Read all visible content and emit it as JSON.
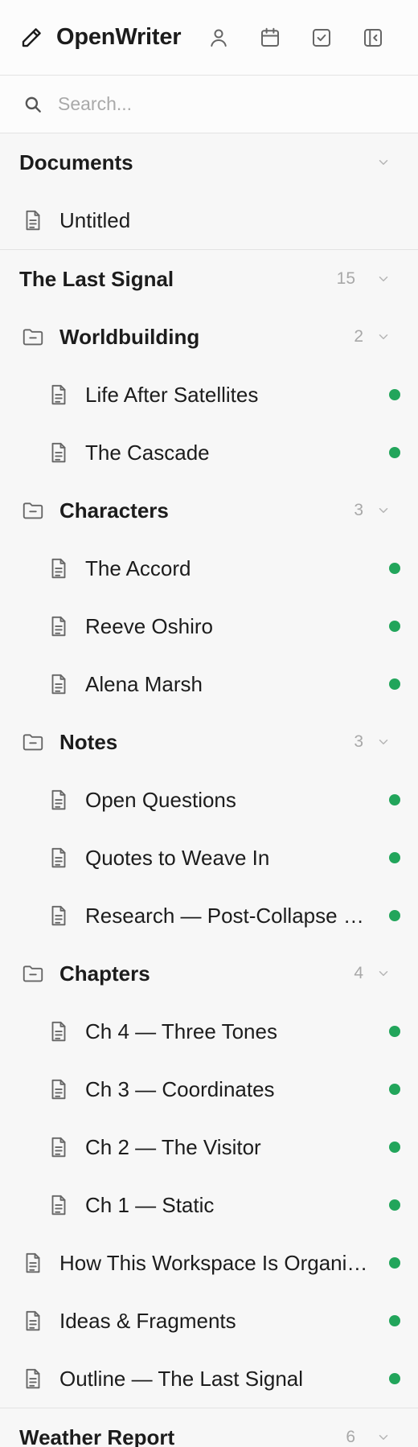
{
  "app": {
    "title": "OpenWriter"
  },
  "colors": {
    "status_dot": "#22a55b",
    "muted": "#a8a8a8",
    "divider": "#e3e3e3"
  },
  "header": {
    "icons": [
      "pencil-icon",
      "user-icon",
      "calendar-icon",
      "checkbox-icon",
      "collapse-sidebar-icon"
    ]
  },
  "search": {
    "placeholder": "Search...",
    "value": ""
  },
  "sections": {
    "documents": {
      "title": "Documents",
      "items": [
        {
          "label": "Untitled"
        }
      ]
    },
    "last_signal": {
      "title": "The Last Signal",
      "count": "15",
      "folders": {
        "worldbuilding": {
          "label": "Worldbuilding",
          "count": "2",
          "items": [
            {
              "label": "Life After Satellites"
            },
            {
              "label": "The Cascade"
            }
          ]
        },
        "characters": {
          "label": "Characters",
          "count": "3",
          "items": [
            {
              "label": "The Accord"
            },
            {
              "label": "Reeve Oshiro"
            },
            {
              "label": "Alena Marsh"
            }
          ]
        },
        "notes": {
          "label": "Notes",
          "count": "3",
          "items": [
            {
              "label": "Open Questions"
            },
            {
              "label": "Quotes to Weave In"
            },
            {
              "label": "Research — Post-Collapse Communications"
            }
          ]
        },
        "chapters": {
          "label": "Chapters",
          "count": "4",
          "items": [
            {
              "label": "Ch 4 — Three Tones"
            },
            {
              "label": "Ch 3 — Coordinates"
            },
            {
              "label": "Ch 2 — The Visitor"
            },
            {
              "label": "Ch 1 — Static"
            }
          ]
        }
      },
      "items": [
        {
          "label": "How This Workspace Is Organized"
        },
        {
          "label": "Ideas & Fragments"
        },
        {
          "label": "Outline — The Last Signal"
        }
      ]
    },
    "weather_report": {
      "title": "Weather Report",
      "count": "6"
    }
  }
}
